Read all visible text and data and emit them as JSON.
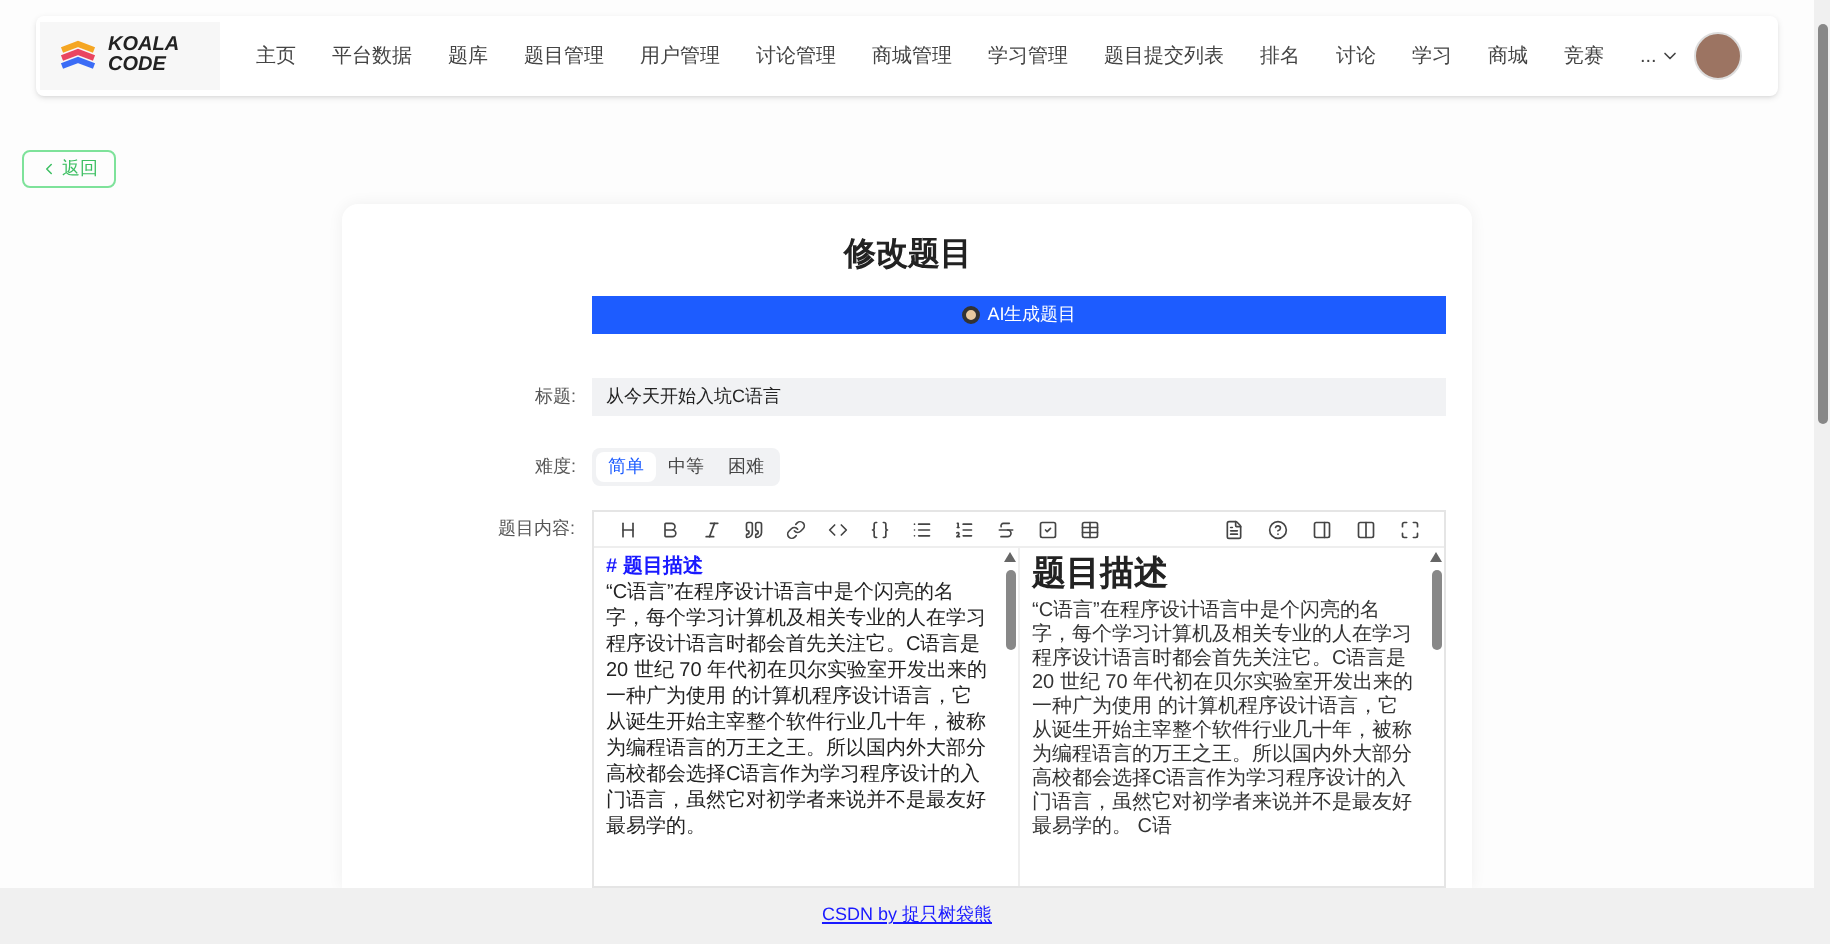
{
  "logo": {
    "line1": "KOALA",
    "line2": "CODE"
  },
  "nav": [
    {
      "label": "主页",
      "selected": false
    },
    {
      "label": "平台数据",
      "selected": false
    },
    {
      "label": "题库",
      "selected": false
    },
    {
      "label": "题目管理",
      "selected": false
    },
    {
      "label": "用户管理",
      "selected": false
    },
    {
      "label": "讨论管理",
      "selected": false
    },
    {
      "label": "商城管理",
      "selected": false
    },
    {
      "label": "学习管理",
      "selected": false
    },
    {
      "label": "题目提交列表",
      "selected": false
    },
    {
      "label": "排名",
      "selected": false
    },
    {
      "label": "讨论",
      "selected": false
    },
    {
      "label": "学习",
      "selected": false
    },
    {
      "label": "商城",
      "selected": false
    },
    {
      "label": "竞赛",
      "selected": false
    }
  ],
  "nav_more": "...",
  "back_button": "返回",
  "form": {
    "heading": "修改题目",
    "ai_button": "AI生成题目",
    "title_label": "标题:",
    "title_value": "从今天开始入坑C语言",
    "difficulty_label": "难度:",
    "difficulty": [
      {
        "label": "简单",
        "selected": true
      },
      {
        "label": "中等",
        "selected": false
      },
      {
        "label": "困难",
        "selected": false
      }
    ],
    "content_label": "题目内容:",
    "editor": {
      "source_heading": "# 题目描述",
      "source_text": "“C语言”在程序设计语言中是个闪亮的名字，每个学习计算机及相关专业的人在学习程序设计语言时都会首先关注它。C语言是 20 世纪 70 年代初在贝尔实验室开发出来的一种广为使用 的计算机程序设计语言，它从诞生开始主宰整个软件行业几十年，被称为编程语言的万王之王。所以国内外大部分高校都会选择C语言作为学习程序设计的入门语言，虽然它对初学者来说并不是最友好最易学的。",
      "preview_heading": "题目描述",
      "preview_text": "“C语言”在程序设计语言中是个闪亮的名字，每个学习计算机及相关专业的人在学习程序设计语言时都会首先关注它。C语言是 20 世纪 70 年代初在贝尔实验室开发出来的一种广为使用 的计算机程序设计语言，它从诞生开始主宰整个软件行业几十年，被称为编程语言的万王之王。所以国内外大部分高校都会选择C语言作为学习程序设计的入门语言，虽然它对初学者来说并不是最友好最易学的。 C语"
    }
  },
  "footer_link": "CSDN by 捉只树袋熊"
}
